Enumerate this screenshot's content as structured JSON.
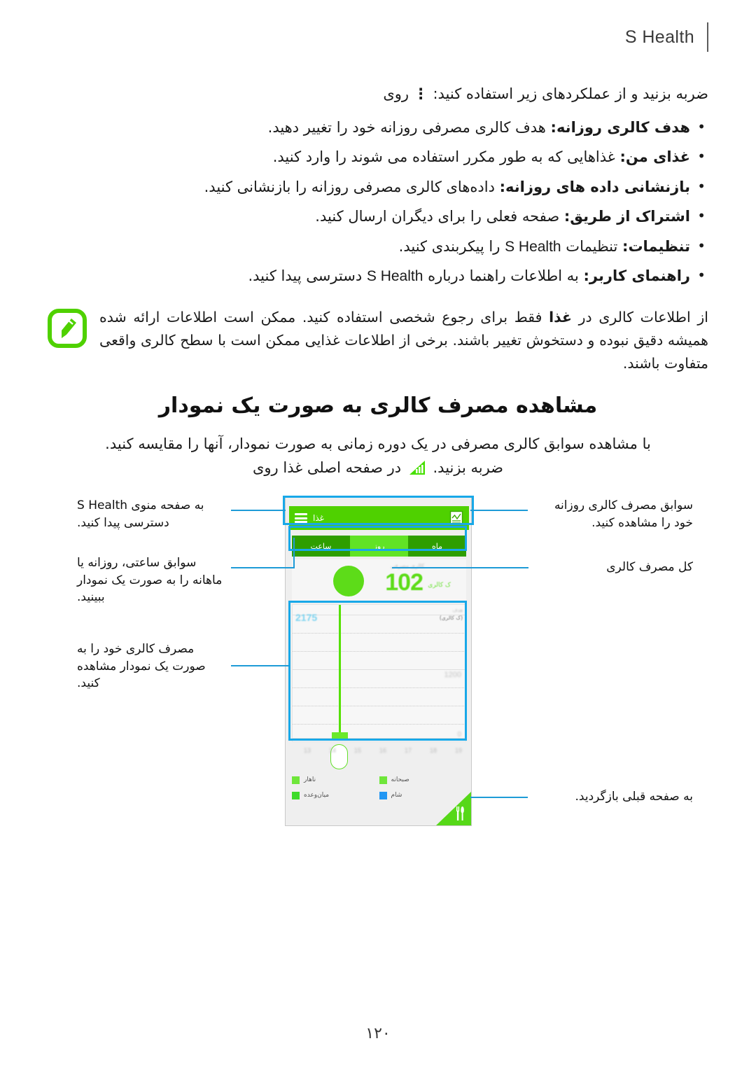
{
  "header": {
    "title": "S Health"
  },
  "intro": {
    "text": "روی   ضربه بزنید و از عملکردهای زیر استفاده کنید:",
    "before": "روی",
    "after": "ضربه بزنید و از عملکردهای زیر استفاده کنید:",
    "menu_glyph": "⋮"
  },
  "bullets": [
    {
      "label": "هدف کالری روزانه:",
      "desc": "هدف کالری مصرفی روزانه خود را تغییر دهید."
    },
    {
      "label": "غذای من:",
      "desc": "غذاهایی که به طور مکرر استفاده می شوند را وارد کنید."
    },
    {
      "label": "بازنشانی داده های روزانه:",
      "desc": "داده‌های کالری مصرفی روزانه را بازنشانی کنید."
    },
    {
      "label": "اشتراک از طریق:",
      "desc": "صفحه فعلی را برای دیگران ارسال کنید."
    },
    {
      "label": "تنظیمات:",
      "desc_pre": "تنظیمات",
      "desc_ltr": "S Health",
      "desc_post": "را پیکربندی کنید."
    },
    {
      "label": "راهنمای کاربر:",
      "desc_pre": "به اطلاعات راهنما درباره",
      "desc_ltr": "S Health",
      "desc_post": "دسترسی پیدا کنید."
    }
  ],
  "note": {
    "icon_name": "note-pencil-icon",
    "accent_color": "#4fd100",
    "part1": "از اطلاعات کالری در",
    "bold": "غذا",
    "part2": "فقط برای رجوع شخصی استفاده کنید. ممکن است اطلاعات ارائه شده همیشه دقیق نبوده و دستخوش تغییر باشند. برخی از اطلاعات غذایی ممکن است با سطح کالری واقعی متفاوت باشند."
  },
  "section": {
    "title": "مشاهده مصرف کالری به صورت یک نمودار",
    "para1": "با مشاهده سوابق کالری مصرفی در یک دوره زمانی به صورت نمودار، آنها را مقایسه کنید.",
    "para2_pre": "در صفحه اصلی غذا روی",
    "para2_post": "ضربه بزنید.",
    "inline_icon_name": "bar-chart-icon"
  },
  "app": {
    "appbar": {
      "title": "غذا",
      "menu_icon": "hamburger-menu-icon",
      "report_icon": "report-chart-icon",
      "color": "#4fd100"
    },
    "tabs": [
      {
        "label": "ساعت",
        "active": false
      },
      {
        "label": "روز",
        "active": true
      },
      {
        "label": "ماه",
        "active": false
      }
    ],
    "summary": {
      "caption": "کالری مصرفی",
      "value": "102",
      "unit": "ک کالری"
    },
    "chart_caption": "هدف",
    "chart_goal_unit": "(ک کالری)",
    "chart_goal_value": "2175",
    "chart_goal_value_unit": "ک کالری",
    "midline_label": "1200",
    "zero_label": "0",
    "xticks": [
      "13",
      "14",
      "15",
      "16",
      "17",
      "18",
      "19"
    ],
    "selected_tick": "18",
    "legend": [
      {
        "label": "صبحانه",
        "color": "#6fe63a"
      },
      {
        "label": "ناهار",
        "color": "#6fe63a"
      },
      {
        "label": "شام",
        "color": "#2196f3"
      },
      {
        "label": "میان‌وعده",
        "color": "#3ddb2a"
      }
    ],
    "fab": {
      "icon": "cutlery-icon",
      "color": "#56d818"
    }
  },
  "callouts": {
    "top_left": "به صفحه منوی S Health دسترسی پیدا کنید.",
    "mid_left": "سوابق ساعتی، روزانه یا ماهانه را به صورت یک نمودار ببینید.",
    "low_left": "مصرف کالری خود را به صورت یک نمودار مشاهده کنید.",
    "top_right": "سوابق مصرف کالری روزانه خود را مشاهده کنید.",
    "mid_right": "کل مصرف کالری",
    "bottom_right": "به صفحه قبلی بازگردید."
  },
  "chart_data": {
    "type": "bar",
    "title": "کالری مصرفی",
    "xlabel": "",
    "ylabel": "ک کالری",
    "categories": [
      "13",
      "14",
      "15",
      "16",
      "17",
      "18",
      "19"
    ],
    "values": [
      0,
      0,
      0,
      0,
      0,
      102,
      0
    ],
    "goal_line": 2175,
    "ylim": [
      0,
      2400
    ],
    "yticks": [
      0,
      1200,
      2175
    ],
    "grid": true,
    "legend_position": "bottom",
    "series": [
      {
        "name": "صبحانه",
        "color": "#6fe63a",
        "values": [
          0,
          0,
          0,
          0,
          0,
          0,
          0
        ]
      },
      {
        "name": "ناهار",
        "color": "#6fe63a",
        "values": [
          0,
          0,
          0,
          0,
          0,
          102,
          0
        ]
      },
      {
        "name": "شام",
        "color": "#2196f3",
        "values": [
          0,
          0,
          0,
          0,
          0,
          0,
          0
        ]
      },
      {
        "name": "میان‌وعده",
        "color": "#3ddb2a",
        "values": [
          0,
          0,
          0,
          0,
          0,
          0,
          0
        ]
      }
    ]
  },
  "page_number": "۱۲۰"
}
